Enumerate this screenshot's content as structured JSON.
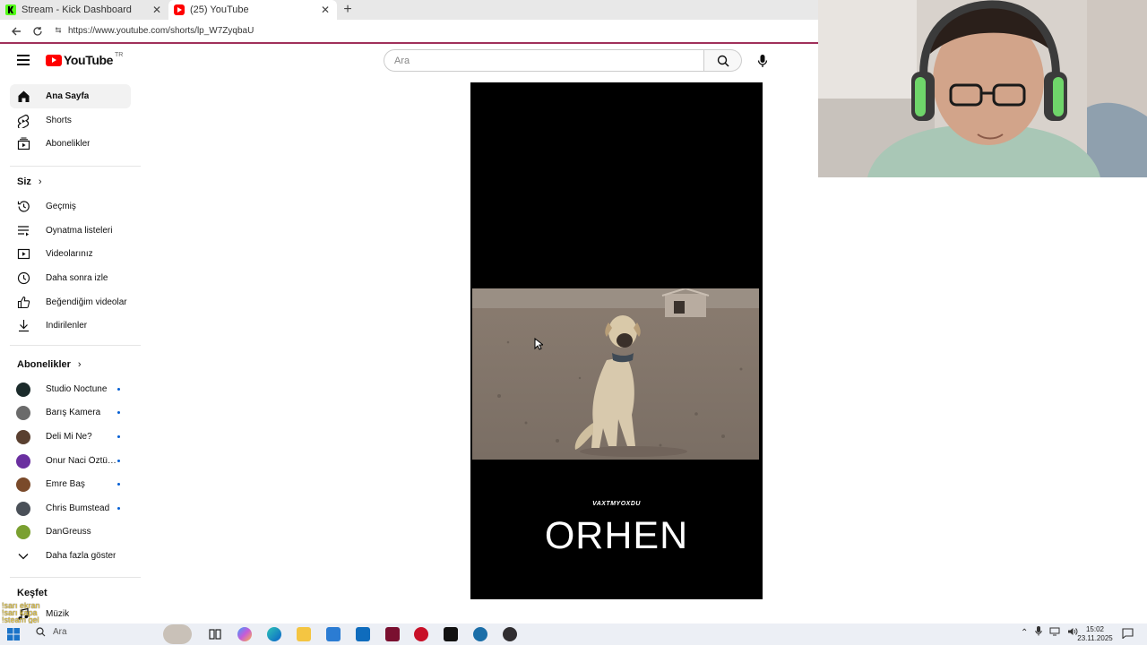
{
  "browser": {
    "tabs": [
      {
        "title": "Stream - Kick Dashboard",
        "active": false
      },
      {
        "title": "(25) YouTube",
        "active": true
      }
    ],
    "url": "https://www.youtube.com/shorts/lp_W7ZyqbaU"
  },
  "youtube": {
    "logo_text": "YouTube",
    "country_code": "TR",
    "search_placeholder": "Ara",
    "nav": [
      {
        "label": "Ana Sayfa",
        "icon": "home-icon",
        "active": true
      },
      {
        "label": "Shorts",
        "icon": "shorts-icon",
        "active": false
      },
      {
        "label": "Abonelikler",
        "icon": "subscriptions-icon",
        "active": false
      }
    ],
    "you_section": {
      "title": "Siz",
      "items": [
        {
          "label": "Geçmiş",
          "icon": "history-icon"
        },
        {
          "label": "Oynatma listeleri",
          "icon": "playlists-icon"
        },
        {
          "label": "Videolarınız",
          "icon": "your-videos-icon"
        },
        {
          "label": "Daha sonra izle",
          "icon": "watch-later-icon"
        },
        {
          "label": "Beğendiğim videolar",
          "icon": "liked-videos-icon"
        },
        {
          "label": "İndirilenler",
          "icon": "downloads-icon"
        }
      ]
    },
    "subscriptions": {
      "title": "Abonelikler",
      "channels": [
        {
          "name": "Studio Noctune",
          "new": true,
          "color": "#1b2b2b"
        },
        {
          "name": "Barış Kamera",
          "new": true,
          "color": "#6b6b6b"
        },
        {
          "name": "Deli Mi Ne?",
          "new": true,
          "color": "#5a4030"
        },
        {
          "name": "Onur Naci Öztürk...",
          "new": true,
          "color": "#6a2fa0"
        },
        {
          "name": "Emre Baş",
          "new": true,
          "color": "#7a4a2a"
        },
        {
          "name": "Chris Bumstead",
          "new": true,
          "color": "#4a5058"
        },
        {
          "name": "DanGreuss",
          "new": false,
          "color": "#7aa030"
        }
      ],
      "show_more": "Daha fazla göster"
    },
    "explore": {
      "title": "Keşfet",
      "items": [
        {
          "label": "Müzik",
          "icon": "music-icon"
        }
      ]
    },
    "short": {
      "caption_small": "VAXTMYOXDU",
      "caption_big": "ORHEN"
    }
  },
  "overlay_chat": [
    "!sarı ekran",
    "!sarı kapa",
    "!steam gel"
  ],
  "taskbar": {
    "search_label": "Ara",
    "time": "15:02",
    "date": "23.11.2025"
  },
  "colors": {
    "yt_red": "#ff0000",
    "kick_green": "#53fc18",
    "new_dot": "#065fd4"
  }
}
